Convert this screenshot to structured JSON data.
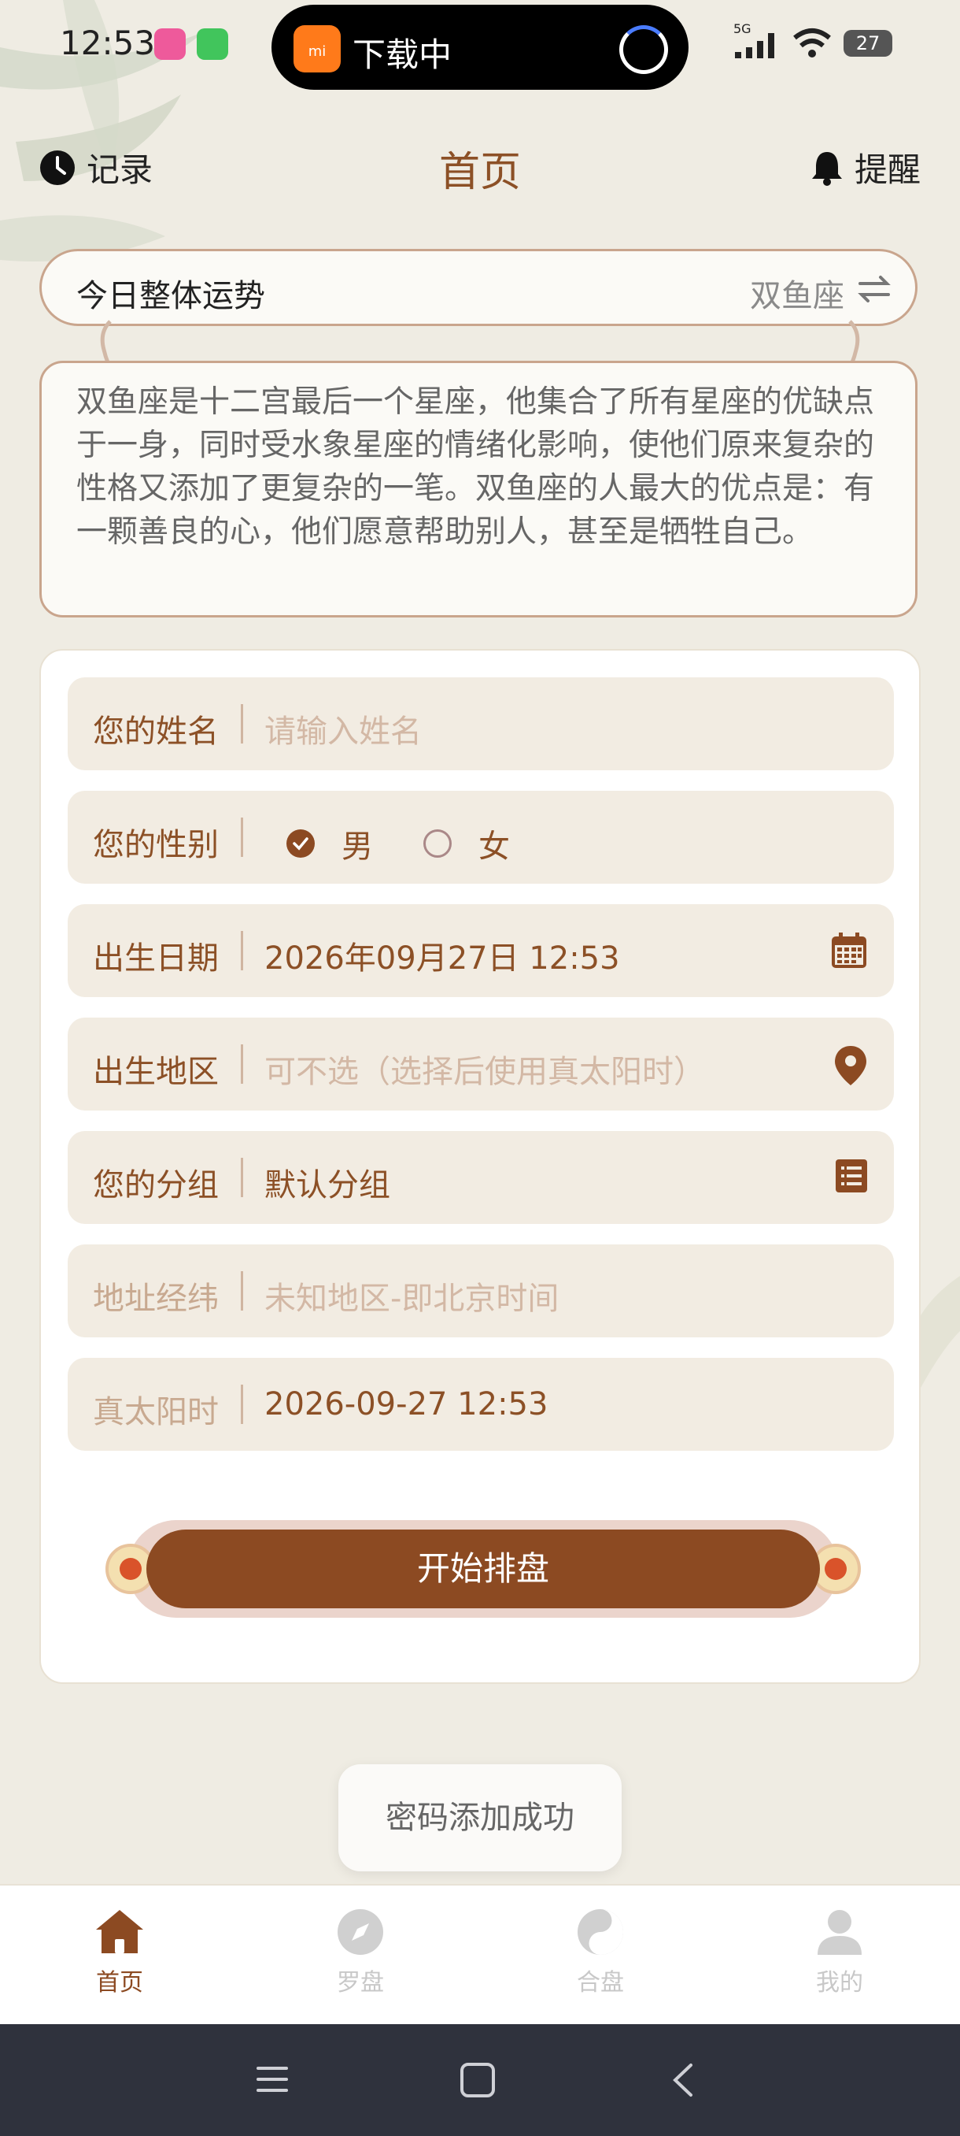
{
  "status_bar": {
    "time": "12:53",
    "island_text": "下载中",
    "battery": "27",
    "network": "5G"
  },
  "header": {
    "record_label": "记录",
    "title": "首页",
    "remind_label": "提醒"
  },
  "fortune": {
    "label": "今日整体运势",
    "sign": "双鱼座",
    "description": "双鱼座是十二宫最后一个星座，他集合了所有星座的优缺点于一身，同时受水象星座的情绪化影响，使他们原来复杂的性格又添加了更复杂的一笔。双鱼座的人最大的优点是：有一颗善良的心，他们愿意帮助别人，甚至是牺牲自己。"
  },
  "form": {
    "name": {
      "label": "您的姓名",
      "placeholder": "请输入姓名"
    },
    "gender": {
      "label": "您的性别",
      "options": [
        "男",
        "女"
      ],
      "selected": "男"
    },
    "birth_date": {
      "label": "出生日期",
      "value": "2026年09月27日 12:53"
    },
    "birth_region": {
      "label": "出生地区",
      "placeholder": "可不选（选择后使用真太阳时）"
    },
    "group": {
      "label": "您的分组",
      "value": "默认分组"
    },
    "coords": {
      "label": "地址经纬",
      "value": "未知地区-即北京时间"
    },
    "solar_time": {
      "label": "真太阳时",
      "value": "2026-09-27 12:53"
    },
    "start_button": "开始排盘"
  },
  "toast": "密码添加成功",
  "tabs": [
    {
      "label": "首页",
      "icon": "home-icon",
      "active": true
    },
    {
      "label": "罗盘",
      "icon": "compass-icon",
      "active": false
    },
    {
      "label": "合盘",
      "icon": "yin-yang-icon",
      "active": false
    },
    {
      "label": "我的",
      "icon": "user-icon",
      "active": false
    }
  ],
  "colors": {
    "accent": "#8c4a22",
    "background": "#efece3",
    "field": "#f2ece2"
  }
}
